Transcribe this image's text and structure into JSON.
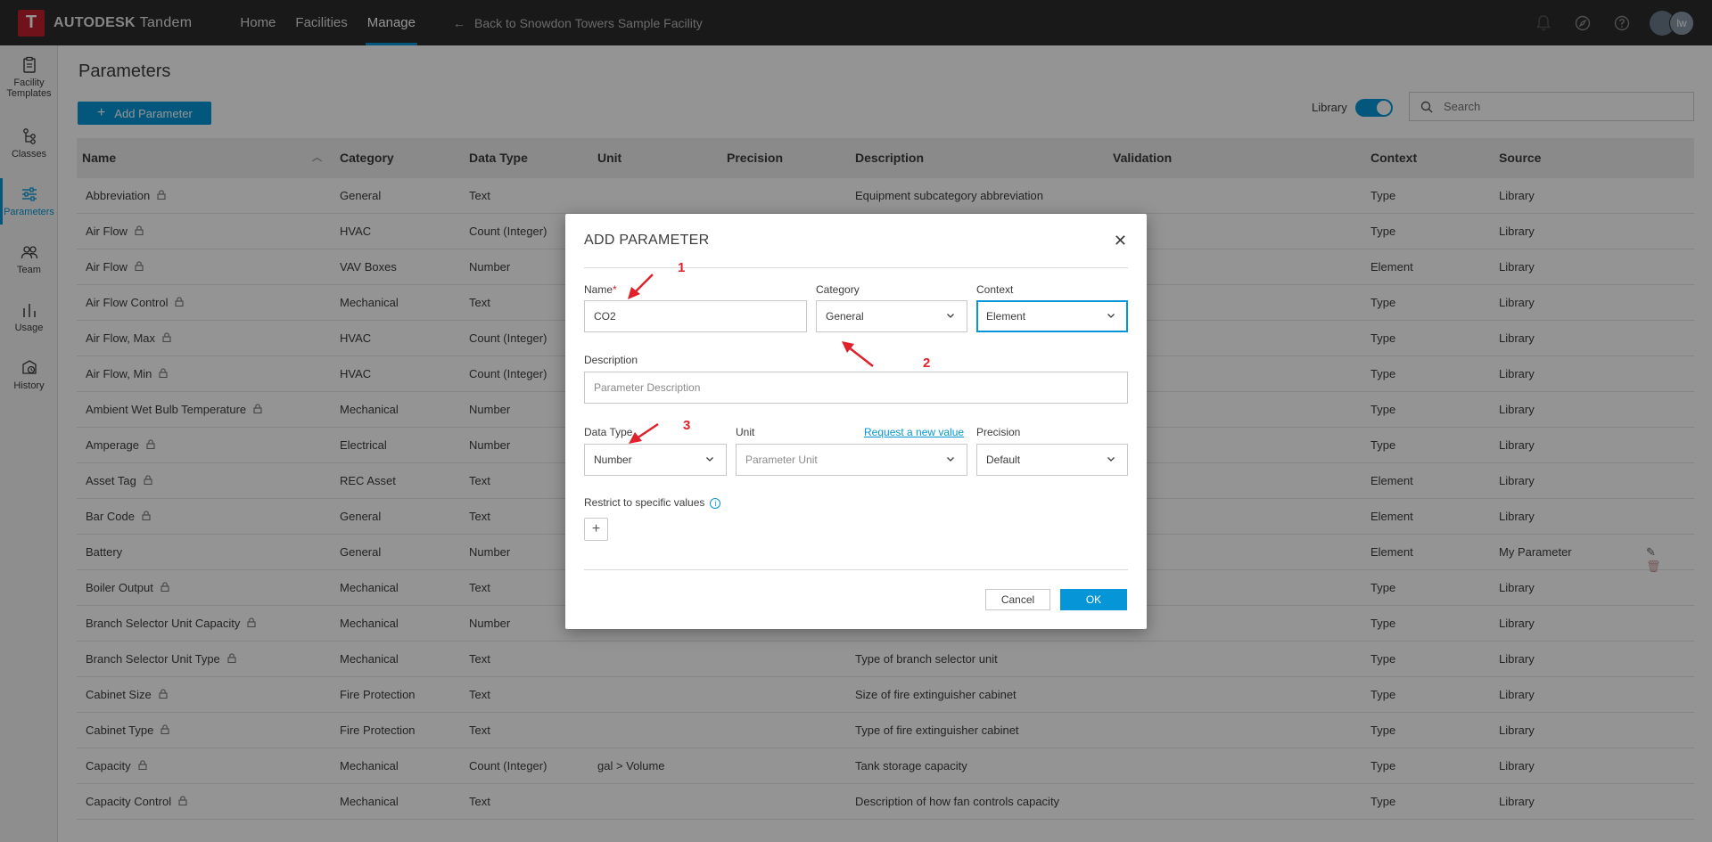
{
  "app": {
    "logo_letter": "T",
    "brand": "AUTODESK",
    "product": "Tandem",
    "nav": [
      {
        "label": "Home",
        "active": false
      },
      {
        "label": "Facilities",
        "active": false
      },
      {
        "label": "Manage",
        "active": true
      }
    ],
    "back_link": "Back to Snowdon Towers Sample Facility",
    "avatar_initials": "lw",
    "accent": "#0696d7"
  },
  "sidebar": {
    "items": [
      {
        "label_line1": "Facility",
        "label_line2": "Templates",
        "icon": "clipboard-icon"
      },
      {
        "label": "Classes",
        "icon": "hierarchy-icon"
      },
      {
        "label": "Parameters",
        "icon": "sliders-icon",
        "active": true
      },
      {
        "label": "Team",
        "icon": "people-icon"
      },
      {
        "label": "Usage",
        "icon": "bar-chart-icon"
      },
      {
        "label": "History",
        "icon": "history-icon"
      }
    ]
  },
  "page": {
    "title": "Parameters",
    "add_button": "Add Parameter",
    "library_label": "Library",
    "library_enabled": true,
    "search_placeholder": "Search"
  },
  "table": {
    "columns": [
      "Name",
      "Category",
      "Data Type",
      "Unit",
      "Precision",
      "Description",
      "Validation",
      "Context",
      "Source"
    ],
    "rows": [
      {
        "name": "Abbreviation",
        "locked": true,
        "category": "General",
        "data_type": "Text",
        "unit": "",
        "description": "Equipment subcategory abbreviation",
        "context": "Type",
        "source": "Library"
      },
      {
        "name": "Air Flow",
        "locked": true,
        "category": "HVAC",
        "data_type": "Count (Integer)",
        "unit": "",
        "description": "",
        "context": "Type",
        "source": "Library"
      },
      {
        "name": "Air Flow",
        "locked": true,
        "category": "VAV Boxes",
        "data_type": "Number",
        "unit": "",
        "description": "",
        "context": "Element",
        "source": "Library"
      },
      {
        "name": "Air Flow Control",
        "locked": true,
        "category": "Mechanical",
        "data_type": "Text",
        "unit": "",
        "description": "",
        "context": "Type",
        "source": "Library"
      },
      {
        "name": "Air Flow, Max",
        "locked": true,
        "category": "HVAC",
        "data_type": "Count (Integer)",
        "unit": "",
        "description": "",
        "context": "Type",
        "source": "Library"
      },
      {
        "name": "Air Flow, Min",
        "locked": true,
        "category": "HVAC",
        "data_type": "Count (Integer)",
        "unit": "",
        "description": "",
        "context": "Type",
        "source": "Library"
      },
      {
        "name": "Ambient Wet Bulb Temperature",
        "locked": true,
        "category": "Mechanical",
        "data_type": "Number",
        "unit": "",
        "description": "",
        "context": "Type",
        "source": "Library"
      },
      {
        "name": "Amperage",
        "locked": true,
        "category": "Electrical",
        "data_type": "Number",
        "unit": "",
        "description": "",
        "context": "Type",
        "source": "Library"
      },
      {
        "name": "Asset Tag",
        "locked": true,
        "category": "REC Asset",
        "data_type": "Text",
        "unit": "",
        "description": "",
        "context": "Element",
        "source": "Library"
      },
      {
        "name": "Bar Code",
        "locked": true,
        "category": "General",
        "data_type": "Text",
        "unit": "",
        "description": "",
        "context": "Element",
        "source": "Library"
      },
      {
        "name": "Battery",
        "locked": false,
        "category": "General",
        "data_type": "Number",
        "unit": "",
        "description": "",
        "context": "Element",
        "source": "My Parameter",
        "editable": true
      },
      {
        "name": "Boiler Output",
        "locked": true,
        "category": "Mechanical",
        "data_type": "Text",
        "unit": "",
        "description": "",
        "context": "Type",
        "source": "Library"
      },
      {
        "name": "Branch Selector Unit Capacity",
        "locked": true,
        "category": "Mechanical",
        "data_type": "Number",
        "unit": "",
        "description": "",
        "context": "Type",
        "source": "Library"
      },
      {
        "name": "Branch Selector Unit Type",
        "locked": true,
        "category": "Mechanical",
        "data_type": "Text",
        "unit": "",
        "description": "Type of branch selector unit",
        "context": "Type",
        "source": "Library"
      },
      {
        "name": "Cabinet Size",
        "locked": true,
        "category": "Fire Protection",
        "data_type": "Text",
        "unit": "",
        "description": "Size of fire extinguisher cabinet",
        "context": "Type",
        "source": "Library"
      },
      {
        "name": "Cabinet Type",
        "locked": true,
        "category": "Fire Protection",
        "data_type": "Text",
        "unit": "",
        "description": "Type of fire extinguisher cabinet",
        "context": "Type",
        "source": "Library"
      },
      {
        "name": "Capacity",
        "locked": true,
        "category": "Mechanical",
        "data_type": "Count (Integer)",
        "unit": "gal > Volume",
        "description": "Tank storage capacity",
        "context": "Type",
        "source": "Library"
      },
      {
        "name": "Capacity Control",
        "locked": true,
        "category": "Mechanical",
        "data_type": "Text",
        "unit": "",
        "description": "Description of how fan controls capacity",
        "context": "Type",
        "source": "Library"
      }
    ]
  },
  "dialog": {
    "title": "ADD PARAMETER",
    "name_label": "Name",
    "required_mark": "*",
    "name_value": "CO2",
    "category_label": "Category",
    "category_value": "General",
    "context_label": "Context",
    "context_value": "Element",
    "description_label": "Description",
    "description_placeholder": "Parameter Description",
    "data_type_label": "Data Type",
    "data_type_value": "Number",
    "unit_label": "Unit",
    "request_link": "Request a new value",
    "unit_placeholder": "Parameter Unit",
    "precision_label": "Precision",
    "precision_value": "Default",
    "restrict_label": "Restrict to specific values",
    "cancel": "Cancel",
    "ok": "OK"
  },
  "annotations": [
    "1",
    "2",
    "3"
  ],
  "annotation_color": "#e0202a"
}
